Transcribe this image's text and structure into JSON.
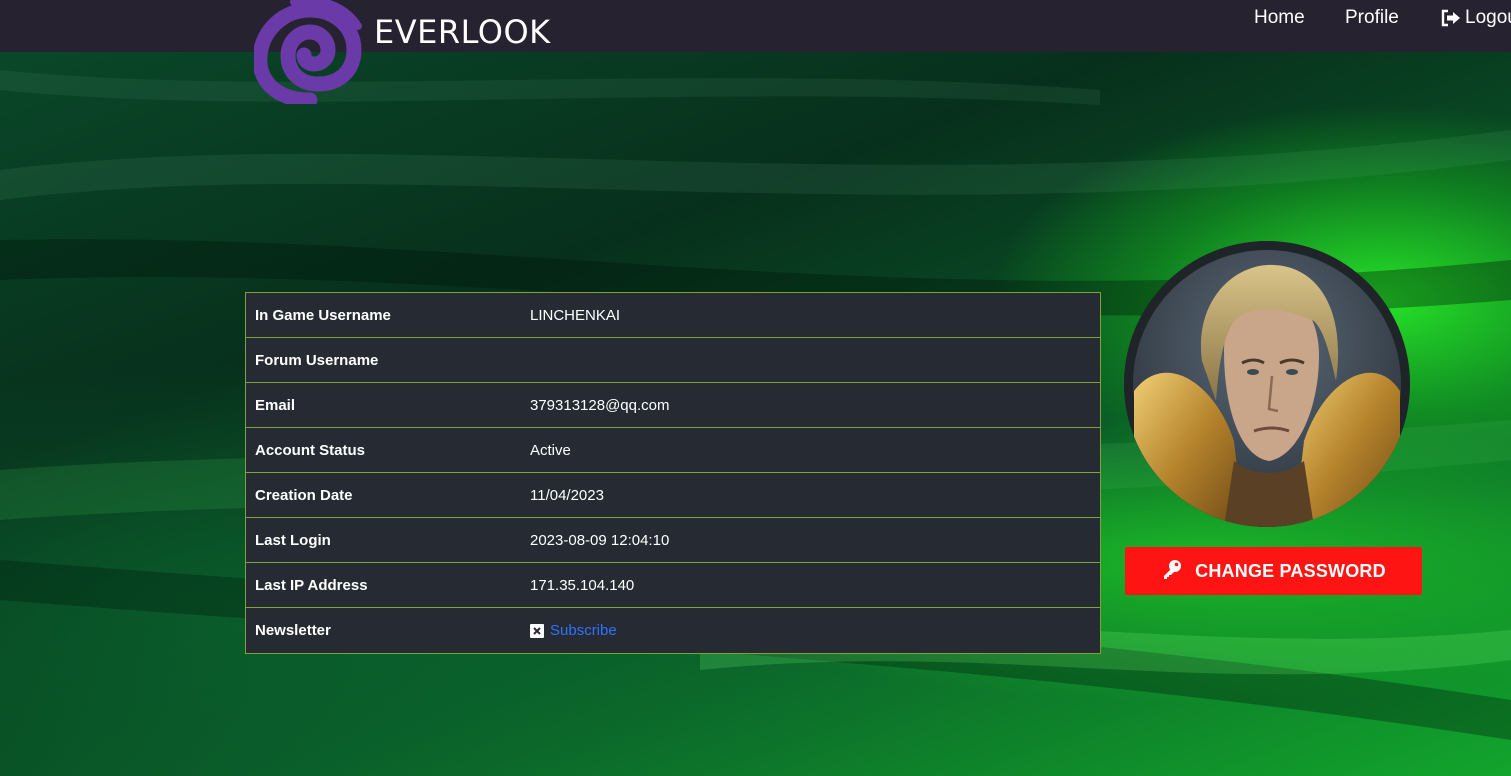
{
  "header": {
    "brand": "EVERLOOK",
    "nav": {
      "home": "Home",
      "profile": "Profile",
      "logout": "Logou"
    },
    "logo_icon": "swirl-logo-icon",
    "logout_icon": "sign-out-icon"
  },
  "account": {
    "rows": [
      {
        "label": "In Game Username",
        "value": "LINCHENKAI"
      },
      {
        "label": "Forum Username",
        "value": ""
      },
      {
        "label": "Email",
        "value": "379313128@qq.com"
      },
      {
        "label": "Account Status",
        "value": "Active"
      },
      {
        "label": "Creation Date",
        "value": "11/04/2023"
      },
      {
        "label": "Last Login",
        "value": "2023-08-09 12:04:10"
      },
      {
        "label": "Last IP Address",
        "value": "171.35.104.140"
      },
      {
        "label": "Newsletter",
        "value": "Subscribe"
      }
    ],
    "newsletter_icon": "x-checkbox-icon"
  },
  "profile": {
    "avatar": "character-portrait",
    "change_password_label": "CHANGE PASSWORD",
    "change_password_icon": "key-icon"
  },
  "colors": {
    "header_bg": "#26222f",
    "table_bg": "#262a33",
    "table_border": "#7fa33b",
    "button_red": "#ff1414",
    "link_blue": "#2f72ff",
    "logo_purple": "#6a3aa8"
  }
}
